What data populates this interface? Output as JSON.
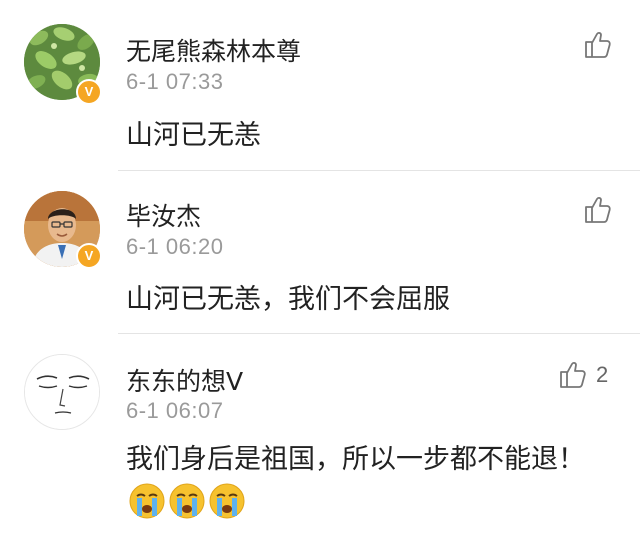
{
  "comments": [
    {
      "name": "无尾熊森林本尊",
      "time": "6-1 07:33",
      "content": "山河已无恙",
      "verified": "V",
      "like_count": "",
      "avatar_icon": "green-leaves-avatar"
    },
    {
      "name": "毕汝杰",
      "time": "6-1 06:20",
      "content": "山河已无恙，我们不会屈服",
      "verified": "V",
      "like_count": "",
      "avatar_icon": "man-portrait-avatar"
    },
    {
      "name": "东东的想V",
      "time": "6-1 06:07",
      "content": "我们身后是祖国，所以一步都不能退！",
      "verified": "",
      "like_count": "2",
      "avatar_icon": "sketch-face-avatar",
      "emojis": [
        "crying-face",
        "crying-face",
        "crying-face"
      ]
    }
  ],
  "colors": {
    "badge": "#f5a623",
    "divider": "#e4e4e4",
    "time": "#9a9a9a"
  }
}
